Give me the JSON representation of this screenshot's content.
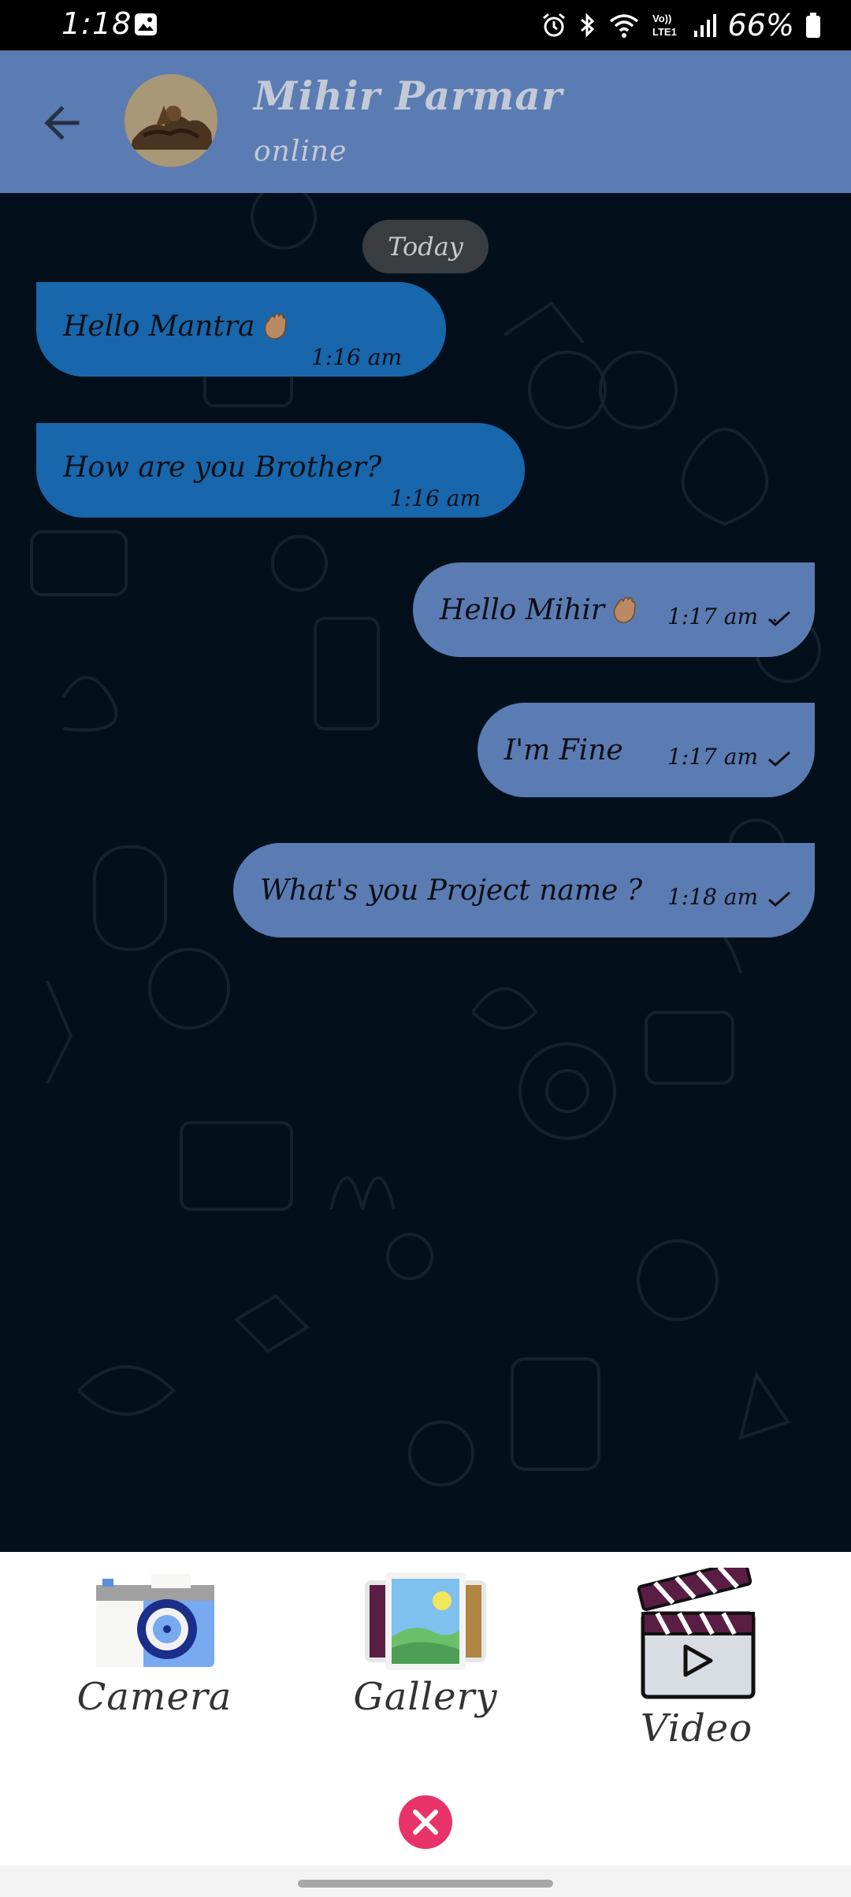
{
  "status_bar": {
    "time": "1:18",
    "battery_text": "66%",
    "icons": [
      "gallery-notification-icon",
      "alarm-icon",
      "bluetooth-icon",
      "wifi-icon",
      "volte-icon",
      "signal-icon",
      "battery-icon"
    ],
    "volte_label": "Vo)) LTE1"
  },
  "header": {
    "contact_name": "Mihir Parmar",
    "contact_status": "online",
    "background_color": "#5b7bb3"
  },
  "chat": {
    "date_label": "Today",
    "messages": [
      {
        "direction": "incoming",
        "text": "Hello Mantra",
        "emoji": "waving-hand",
        "time": "1:16 am"
      },
      {
        "direction": "incoming",
        "text": "How are you Brother?",
        "time": "1:16 am"
      },
      {
        "direction": "outgoing",
        "text": "Hello Mihir",
        "emoji": "waving-hand",
        "time": "1:17 am",
        "status": "sent"
      },
      {
        "direction": "outgoing",
        "text": "I'm  Fine",
        "time": "1:17 am",
        "status": "sent"
      },
      {
        "direction": "outgoing",
        "text": "What's you Project name ?",
        "time": "1:18 am",
        "status": "sent"
      }
    ],
    "incoming_color": "#1866ac",
    "outgoing_color": "#5b7bb3"
  },
  "attachments": {
    "options": [
      {
        "label": "Camera",
        "icon": "camera-icon"
      },
      {
        "label": "Gallery",
        "icon": "gallery-icon"
      },
      {
        "label": "Video",
        "icon": "clapperboard-icon"
      }
    ],
    "close_icon": "close-icon",
    "close_color": "#e8336a"
  }
}
